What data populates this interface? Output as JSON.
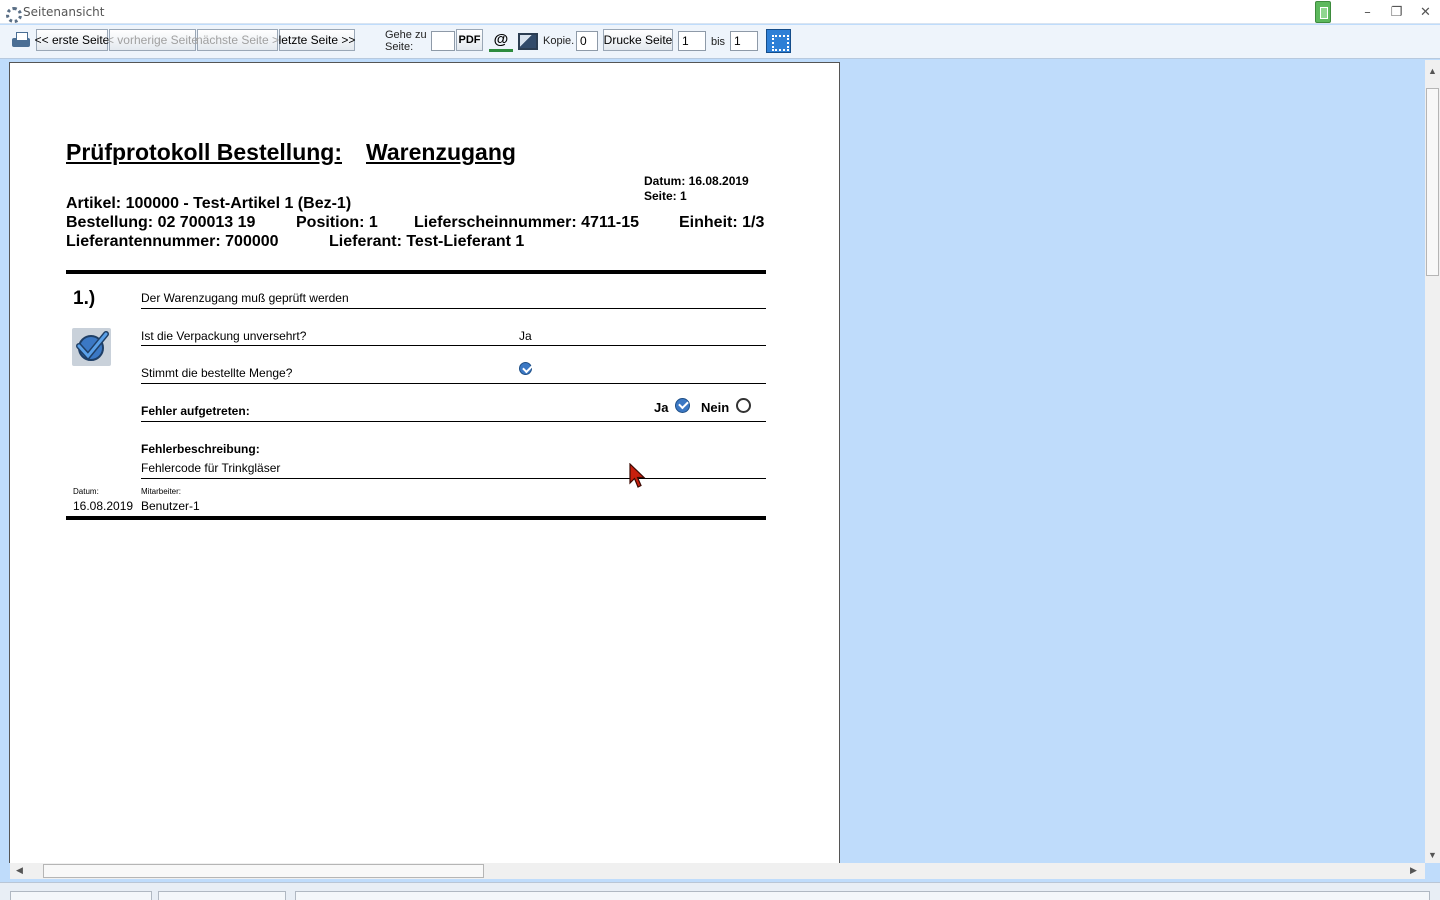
{
  "window": {
    "title": "Seitenansicht",
    "controls": {
      "minimize": "–",
      "maximize": "❐",
      "close": "✕"
    }
  },
  "toolbar": {
    "first_page": "<< erste Seite",
    "prev_page": "< vorherige Seite",
    "next_page": "nächste Seite >",
    "last_page": "letzte Seite >>",
    "goto_label": "Gehe zu Seite:",
    "goto_value": "",
    "pdf": "PDF",
    "email": "@",
    "copies_label": "Kopie.",
    "copies_value": "0",
    "print_page": "Drucke Seite",
    "page_from": "1",
    "bis_label": "bis",
    "page_to": "1"
  },
  "document": {
    "title_left": "Prüfprotokoll Bestellung:",
    "title_right": "Warenzugang",
    "date_line": "Datum: 16.08.2019",
    "page_line": "Seite: 1",
    "artikel": "Artikel: 100000 - Test-Artikel 1  (Bez-1)",
    "bestellung": "Bestellung: 02 700013 19",
    "position": "Position: 1",
    "lieferschein": "Lieferscheinnummer: 4711-15",
    "einheit": "Einheit: 1/3",
    "lieferantennummer": "Lieferantennummer: 700000",
    "lieferant": "Lieferant: Test-Lieferant 1",
    "section_number": "1.)",
    "rows": {
      "heading": "Der Warenzugang muß geprüft werden",
      "verpackung_q": "Ist die Verpackung unversehrt?",
      "verpackung_a": "Ja",
      "menge_q": "Stimmt die bestellte Menge?",
      "fehler_q": "Fehler aufgetreten:",
      "ja": "Ja",
      "nein": "Nein",
      "beschreibung_label": "Fehlerbeschreibung:",
      "beschreibung_value": "Fehlercode für Trinkgläser"
    },
    "footer": {
      "datum_label": "Datum:",
      "datum_value": "16.08.2019",
      "mitarbeiter_label": "Mitarbeiter:",
      "mitarbeiter_value": "Benutzer-1"
    }
  },
  "icons": {
    "printer": "printer-icon",
    "image": "image-icon",
    "fit": "fit-page-icon",
    "check": "check-icon"
  },
  "colors": {
    "viewport_bg": "#bfdcfb",
    "check_blue": "#3b78c4",
    "fit_button": "#2d7fd6"
  }
}
